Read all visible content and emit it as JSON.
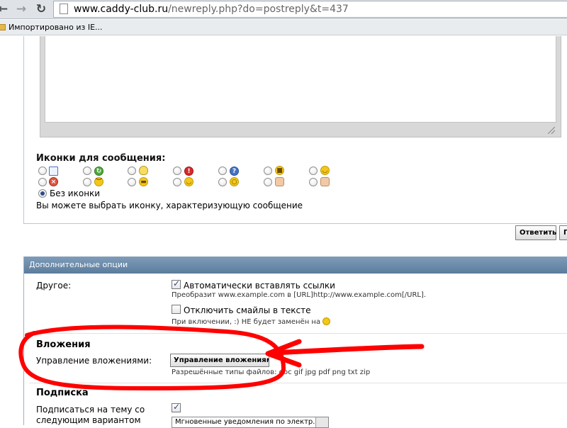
{
  "browser": {
    "url_domain": "www.caddy-club.ru",
    "url_path": "/newreply.php?do=postreply&t=437",
    "bookmark_label": "Импортировано из IE..."
  },
  "icons_section": {
    "title": "Иконки для сообщения:",
    "no_icon_label": "Без иконки",
    "hint": "Вы можете выбрать иконку, характеризующую сообщение",
    "icons": [
      "document-icon",
      "arrow-icon",
      "lightbulb-icon",
      "exclamation-icon",
      "question-icon",
      "cool-icon",
      "smile-icon",
      "angry-icon",
      "frown-icon",
      "mad-icon",
      "tongue-icon",
      "eek-icon",
      "thumbs-down-icon",
      "thumbs-up-icon"
    ]
  },
  "buttons": {
    "reply": "Ответить",
    "preview": "Пр"
  },
  "options": {
    "header": "Дополнительные опции",
    "other_label": "Другое:",
    "auto_links_label": "Автоматически вставлять ссылки",
    "auto_links_checked": true,
    "auto_links_help": "Преобразит www.example.com в [URL]http://www.example.com[/URL].",
    "disable_smilies_label": "Отключить смайлы в тексте",
    "disable_smilies_checked": false,
    "smilies_help": "При включении, :) НЕ будет заменён на",
    "attachments_title": "Вложения",
    "manage_attachments_label": "Управление вложениями:",
    "manage_attachments_button": "Управление вложениями",
    "allowed_types": "Разрешённые типы файлов: doc gif jpg pdf png txt zip",
    "subscription_title": "Подписка",
    "subscribe_label_line1": "Подписаться на тему со",
    "subscribe_label_line2": "следующим вариантом",
    "subscribe_checked": true,
    "subscribe_select": "Мгновенные уведомления по электр..."
  },
  "colors": {
    "header_blue": "#6b89a8",
    "annotation_red": "#ff0000"
  }
}
